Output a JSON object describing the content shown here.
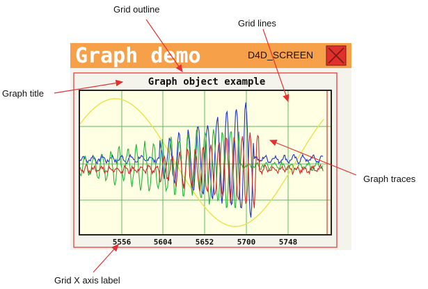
{
  "screen": {
    "banner_title": "Graph demo",
    "screen_name": "D4D_SCREEN",
    "close_icon": "close-x-icon",
    "colors": {
      "banner": "#f7a04a",
      "banner_text": "#ffffff",
      "close_button": "#e0302b",
      "screen_background": "#f4f4ec",
      "grid_background": "#ffffe3",
      "grid_lines": "#5fb85f",
      "outline": "#e53030"
    }
  },
  "graph": {
    "title": "Graph object example",
    "x_axis_labels": [
      "5556",
      "5604",
      "5652",
      "5700",
      "5748"
    ]
  },
  "callouts": {
    "grid_outline": "Grid outline",
    "grid_lines": "Grid lines",
    "graph_title": "Graph title",
    "graph_traces": "Graph traces",
    "x_axis_label": "Grid X axis label"
  },
  "chart_data": {
    "type": "line",
    "title": "Graph object example",
    "x_tick_labels": [
      "5556",
      "5604",
      "5652",
      "5700",
      "5748"
    ],
    "xlim": [
      5530,
      5797
    ],
    "series": [
      {
        "color": "#e8e34a",
        "shape": "sine",
        "cycles": 1.05,
        "amplitude": 0.92,
        "offset": 0.0
      },
      {
        "color": "#1f2fd6",
        "shape": "noisy-burst",
        "burst_start": 5615,
        "burst_end": 5715,
        "peak_amplitude": 0.85,
        "baseline": 0.05
      },
      {
        "color": "#22b53a",
        "shape": "noisy-burst",
        "burst_start": 5540,
        "burst_end": 5700,
        "peak_amplitude": 0.6,
        "baseline": -0.05
      },
      {
        "color": "#d2262a",
        "shape": "noisy-burst",
        "burst_start": 5615,
        "burst_end": 5720,
        "peak_amplitude": 0.55,
        "baseline": -0.1
      }
    ]
  }
}
